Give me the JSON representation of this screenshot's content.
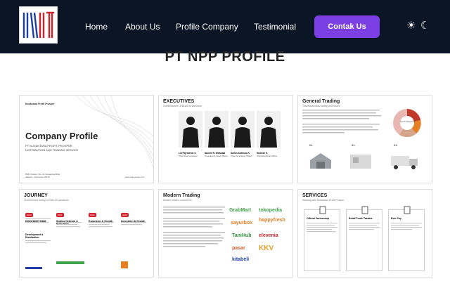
{
  "nav": {
    "links": [
      "Home",
      "About Us",
      "Profile Company",
      "Testimonial"
    ],
    "cta": "Contak Us",
    "theme_icons": [
      "☀",
      "☾"
    ]
  },
  "page": {
    "title": "PT NPP PROFILE"
  },
  "cards": {
    "company": {
      "brand": "Nusantara Profit Prosper",
      "title": "Company Profile",
      "sub1": "PT NUSANTARA PROFIT PROSPER",
      "sub2": "DISTRIBUTION AND TRADING SERVICE",
      "address": "BSD Cluster / Ds. 21 Nusantara Blok",
      "address2": "Jakarta - Indonesia 15143",
      "web": "www.npp-group.com"
    },
    "executives": {
      "title": "EXECUTIVES",
      "subtitle": "Commissioner & Board of Directors",
      "people": [
        {
          "name": "Lili Fajerbesin S.",
          "role": "Chief Commissioner"
        },
        {
          "name": "Nunnie R. Wiranata",
          "role": "President & Chief Officer"
        },
        {
          "name": "Darius Sutrisko K.",
          "role": "Chief Operating Officer"
        },
        {
          "name": "Noorlan S.",
          "role": "Chief Financial Officer"
        }
      ]
    },
    "general": {
      "title": "General Trading",
      "subtitle": "Traditional retail trading and stores",
      "steps": [
        "01.",
        "02.",
        "03."
      ],
      "pie_label": "Top 5 Categories"
    },
    "journey": {
      "title": "JOURNEY",
      "subtitle": "Commenced during COVID-19 pandemic",
      "stages": [
        "Exploration Stage",
        "Scaling Network & Evaluation",
        "Expansion & Growth",
        "Innovation & Growth",
        "Development & Distribution"
      ],
      "years": [
        "2020",
        "2021",
        "2022",
        "2023"
      ]
    },
    "modern": {
      "title": "Modern Trading",
      "subtitle": "Modern retail e-commerce",
      "brands": [
        "GrabMart",
        "tokopedia",
        "sayurbox",
        "happyfresh",
        "TaniHub",
        "elevenia",
        "pasar",
        "KKV",
        "kitabeli"
      ]
    },
    "services": {
      "title": "SERVICES",
      "subtitle": "Working with Nusantara Profit Prosper",
      "items": [
        "Official Partnership",
        "Retail Trade Taxable",
        "Ever Pay"
      ]
    }
  },
  "colors": {
    "nav_bg": "#0a1626",
    "cta": "#7b3fe4"
  }
}
